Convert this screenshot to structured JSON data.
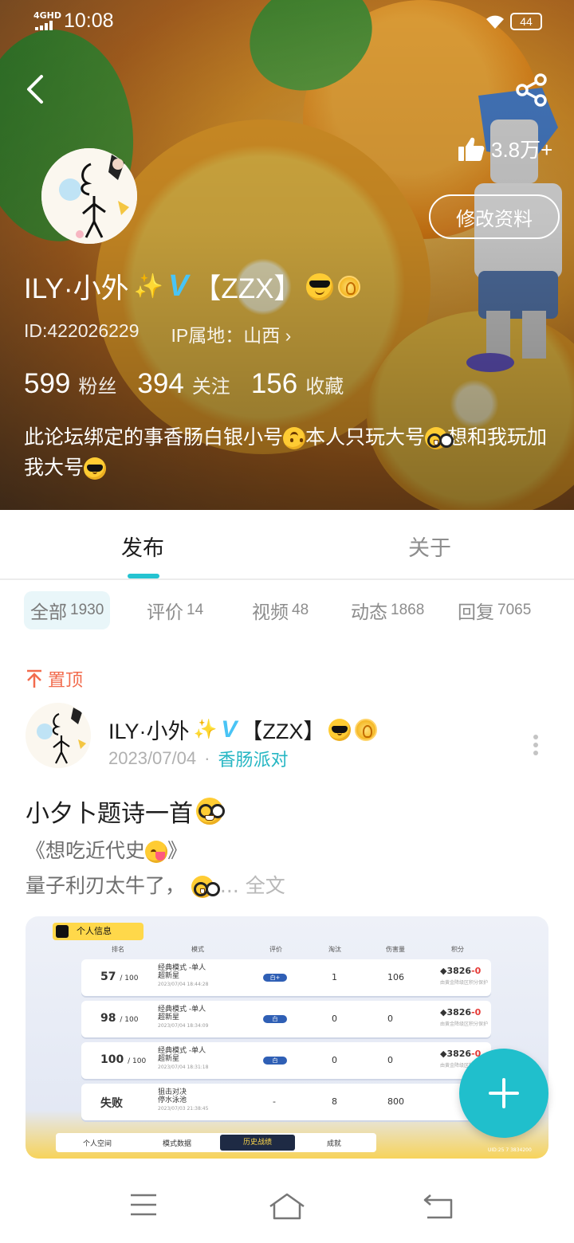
{
  "status_bar": {
    "network": "4GHD",
    "time": "10:08",
    "battery": "44"
  },
  "header": {
    "likes": "3.8万+",
    "edit_profile_label": "修改资料"
  },
  "profile": {
    "name_prefix": "ILY·小外",
    "name_suffix": "【ZZX】",
    "id": "ID:422026229",
    "ip_location": "IP属地：山西 ›",
    "stats": [
      {
        "value": "599",
        "label": "粉丝"
      },
      {
        "value": "394",
        "label": "关注"
      },
      {
        "value": "156",
        "label": "收藏"
      }
    ],
    "bio_part1": "此论坛绑定的事香肠白银小号",
    "bio_part2": "本人只玩大号",
    "bio_part3": "想和我玩加我大号"
  },
  "tabs": [
    {
      "label": "发布",
      "active": true
    },
    {
      "label": "关于",
      "active": false
    }
  ],
  "filters": [
    {
      "label": "全部",
      "count": "1930",
      "active": true
    },
    {
      "label": "评价",
      "count": "14",
      "active": false
    },
    {
      "label": "视频",
      "count": "48",
      "active": false
    },
    {
      "label": "动态",
      "count": "1868",
      "active": false
    },
    {
      "label": "回复",
      "count": "7065",
      "active": false
    }
  ],
  "post": {
    "pinned_label": "置顶",
    "author_prefix": "ILY·小外",
    "author_suffix": "【ZZX】",
    "date": "2023/07/04",
    "separator": "·",
    "topic": "香肠派对",
    "title": "小夕卜题诗一首",
    "body_line1": "《想吃近代史",
    "body_line1_end": "》",
    "body_line2": "量子利刃太牛了，",
    "ellipsis": "...",
    "full_text_label": "全文"
  },
  "screenshot": {
    "header": "个人信息",
    "columns": [
      "排名",
      "模式",
      "评价",
      "淘汰",
      "伤害量",
      "积分"
    ],
    "rows": [
      {
        "rank": "57",
        "of": "/ 100",
        "mode": "经典模式 -单人",
        "map": "超新星",
        "time": "2023/07/04 18:44:28",
        "rating": "白+",
        "elims": "1",
        "damage": "106",
        "score": "3826",
        "delta": "-0",
        "note": "由黄金降级区积分保护"
      },
      {
        "rank": "98",
        "of": "/ 100",
        "mode": "经典模式 -单人",
        "map": "超新星",
        "time": "2023/07/04 18:34:09",
        "rating": "白",
        "elims": "0",
        "damage": "0",
        "score": "3826",
        "delta": "-0",
        "note": "由黄金降级区积分保护"
      },
      {
        "rank": "100",
        "of": "/ 100",
        "mode": "经典模式 -单人",
        "map": "超新星",
        "time": "2023/07/04 18:31:18",
        "rating": "白",
        "elims": "0",
        "damage": "0",
        "score": "3826",
        "delta": "-0",
        "note": "由黄金降级区积分保护"
      },
      {
        "rank": "失败",
        "of": "",
        "mode": "狙击对决",
        "map": "停水泳池",
        "time": "2023/07/03 21:38:45",
        "rating": "-",
        "elims": "8",
        "damage": "800",
        "score": "",
        "delta": "",
        "note": ""
      }
    ],
    "bottom_tabs": [
      "个人空间",
      "模式数据",
      "历史战绩",
      "成就"
    ],
    "uid": "UID:25 7 3834200"
  },
  "colors": {
    "accent": "#25c3d1",
    "pinned": "#f26b4d",
    "verified": "#49c4f5",
    "fab": "#20bfcc"
  }
}
